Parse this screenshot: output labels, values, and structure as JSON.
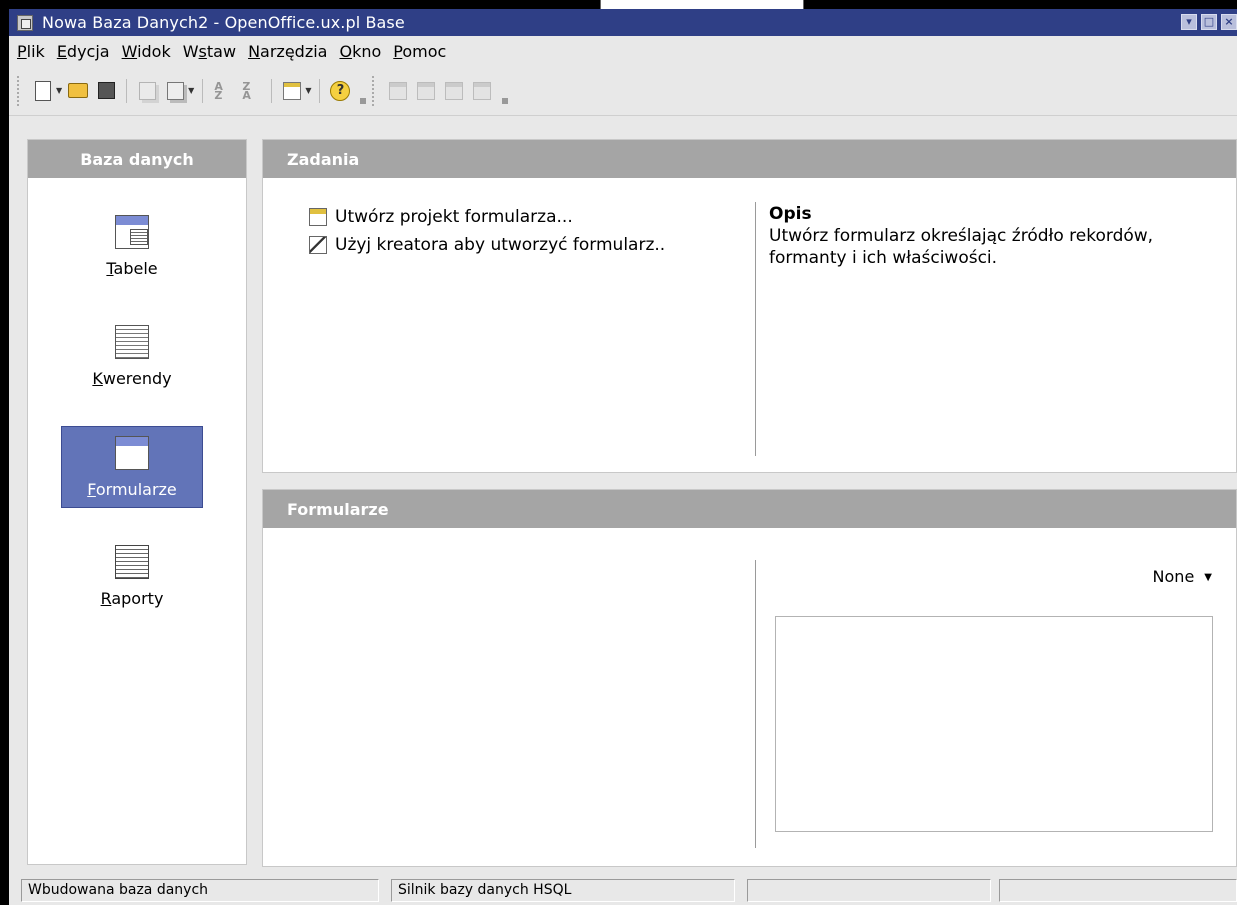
{
  "window": {
    "title": "Nowa Baza Danych2 - OpenOffice.ux.pl Base"
  },
  "menu": [
    {
      "pre": "",
      "key": "P",
      "post": "lik"
    },
    {
      "pre": "",
      "key": "E",
      "post": "dycja"
    },
    {
      "pre": "",
      "key": "W",
      "post": "idok"
    },
    {
      "pre": "W",
      "key": "s",
      "post": "taw"
    },
    {
      "pre": "",
      "key": "N",
      "post": "arzędzia"
    },
    {
      "pre": "",
      "key": "O",
      "post": "kno"
    },
    {
      "pre": "",
      "key": "P",
      "post": "omoc"
    }
  ],
  "toolbar": {
    "icons": [
      "new-document-icon",
      "open-folder-icon",
      "save-icon",
      "copy-icon",
      "paste-icon",
      "sort-ascending-icon",
      "sort-descending-icon",
      "form-icon",
      "help-icon",
      "table-view-icon",
      "form-view-icon",
      "query-view-icon",
      "report-view-icon"
    ],
    "help_glyph": "?"
  },
  "sidebar": {
    "header": "Baza danych",
    "items": [
      {
        "key": "T",
        "rest": "abele",
        "icon": "tables-icon",
        "active": false
      },
      {
        "key": "K",
        "rest": "werendy",
        "icon": "queries-icon",
        "active": false
      },
      {
        "key": "F",
        "rest": "ormularze",
        "icon": "forms-icon",
        "active": true
      },
      {
        "key": "R",
        "rest": "aporty",
        "icon": "reports-icon",
        "active": false
      }
    ]
  },
  "tasks": {
    "header": "Zadania",
    "items": [
      {
        "label": "Utwórz projekt formularza...",
        "icon": "form-design-icon"
      },
      {
        "label": "Użyj kreatora aby utworzyć formularz..",
        "icon": "form-wizard-icon"
      }
    ],
    "description": {
      "title": "Opis",
      "text": "Utwórz formularz określając źródło rekordów, formanty i ich właściwości."
    }
  },
  "forms": {
    "header": "Formularze",
    "preview_select": "None"
  },
  "statusbar": {
    "cells": [
      "Wbudowana baza danych",
      "Silnik bazy danych HSQL",
      "",
      ""
    ]
  },
  "colors": {
    "titlebar": "#2f3f86",
    "panel_header": "#a5a5a5",
    "active_item": "#6274b8",
    "window_bg": "#e8e8e8"
  }
}
